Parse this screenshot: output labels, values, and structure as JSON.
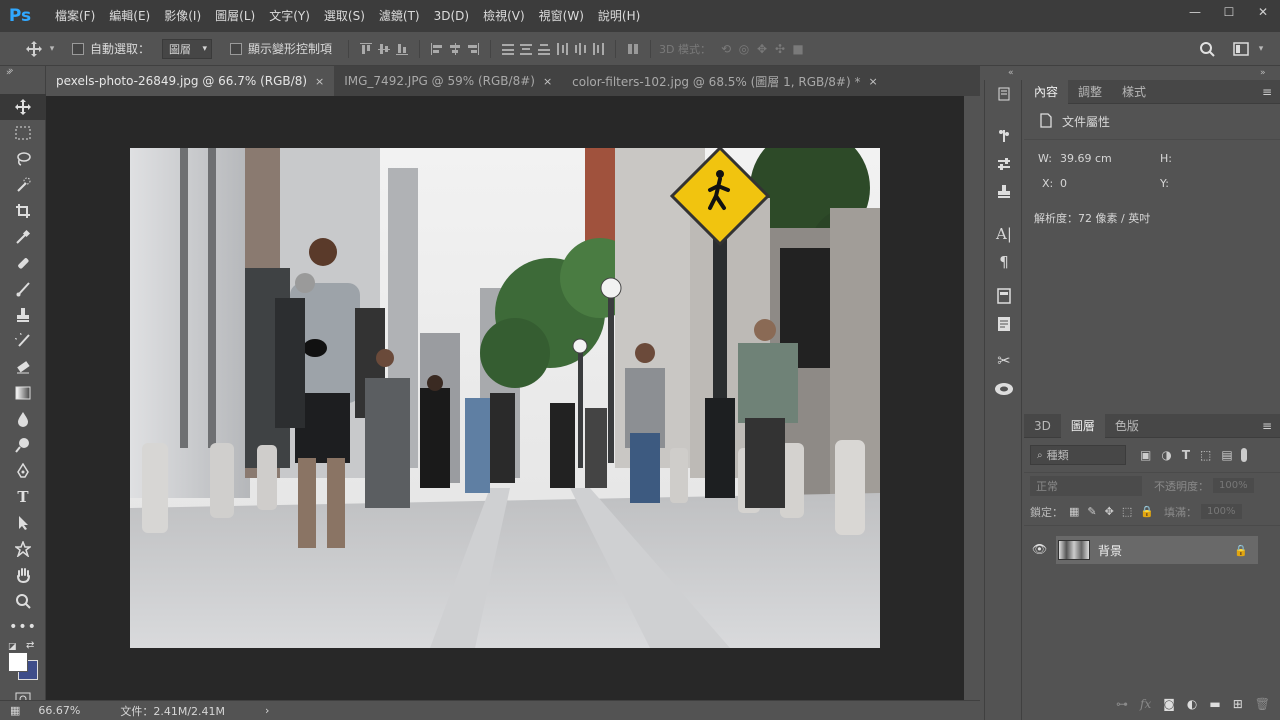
{
  "app": {
    "logo": "Ps"
  },
  "menu": [
    "檔案(F)",
    "編輯(E)",
    "影像(I)",
    "圖層(L)",
    "文字(Y)",
    "選取(S)",
    "濾鏡(T)",
    "3D(D)",
    "檢視(V)",
    "視窗(W)",
    "說明(H)"
  ],
  "window_buttons": {
    "minimize": "—",
    "maximize": "☐",
    "close": "✕"
  },
  "options": {
    "auto_select_label": "自動選取：",
    "auto_select_value": "圖層",
    "show_transform_label": "顯示變形控制項",
    "mode_3d_label": "3D 模式："
  },
  "tabs": [
    {
      "label": "pexels-photo-26849.jpg @ 66.7% (RGB/8)",
      "active": true
    },
    {
      "label": "IMG_7492.JPG @ 59% (RGB/8#)",
      "active": false
    },
    {
      "label": "color-filters-102.jpg @ 68.5% (圖層 1, RGB/8#) *",
      "active": false
    }
  ],
  "tab_close": "×",
  "status": {
    "zoom": "66.67%",
    "doc": "文件：2.41M/2.41M",
    "arrow": "›"
  },
  "properties": {
    "tabs": [
      "內容",
      "調整",
      "樣式"
    ],
    "header": "文件屬性",
    "w_label": "W:",
    "w_value": "39.69 cm",
    "h_label": "H:",
    "h_value": "",
    "x_label": "X:",
    "x_value": "0",
    "y_label": "Y:",
    "y_value": "",
    "resolution": "解析度：72 像素 / 英吋"
  },
  "layers": {
    "tabs": [
      "3D",
      "圖層",
      "色版"
    ],
    "filter_placeholder": "種類",
    "blend_mode": "正常",
    "opacity_label": "不透明度：",
    "opacity_value": "100%",
    "lock_label": "鎖定：",
    "fill_label": "填滿：",
    "fill_value": "100%",
    "layer_name": "背景"
  },
  "panel_menu_icon": "≡",
  "colors": {
    "accent": "#31a8ff",
    "background": "#535353",
    "canvas": "#282828"
  }
}
